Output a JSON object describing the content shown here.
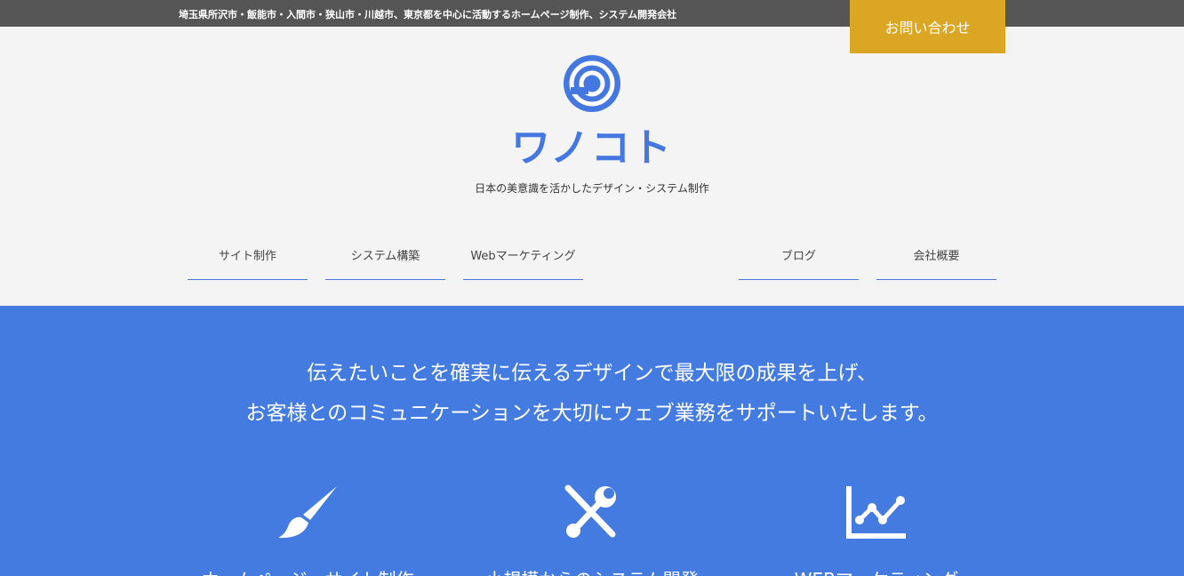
{
  "header": {
    "tagline": "埼玉県所沢市・飯能市・入間市・狭山市・川越市、東京都を中心に活動するホームページ制作、システム開発会社",
    "contact_label": "お問い合わせ"
  },
  "logo": {
    "name": "ワノコト",
    "subtitle": "日本の美意識を活かしたデザイン・システム制作",
    "icon": "logo-circle-icon"
  },
  "nav": {
    "items": [
      {
        "label": "サイト制作"
      },
      {
        "label": "システム構築"
      },
      {
        "label": "Webマーケティング"
      },
      {
        "label": "ブログ"
      },
      {
        "label": "会社概要"
      }
    ]
  },
  "hero": {
    "line1": "伝えたいことを確実に伝えるデザインで最大限の成果を上げ、",
    "line2": "お客様とのコミュニケーションを大切にウェブ業務をサポートいたします。"
  },
  "services": [
    {
      "title": "ホームページ・サイト制作",
      "icon": "paintbrush-icon"
    },
    {
      "title": "小規模からのシステム開発",
      "icon": "tools-icon"
    },
    {
      "title": "WEBマーケティング",
      "icon": "line-chart-icon"
    }
  ],
  "colors": {
    "brand_blue": "#447be0",
    "contact_gold": "#dba624",
    "topbar_gray": "#555555",
    "page_background": "#f4f4f4"
  }
}
